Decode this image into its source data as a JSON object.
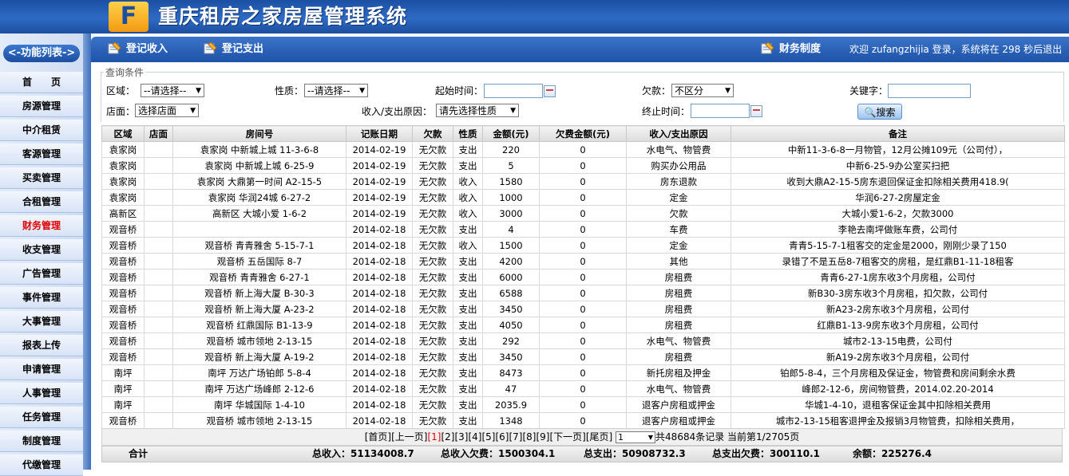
{
  "header": {
    "logo_text": "F",
    "title": "重庆租房之家房屋管理系统"
  },
  "sidebar": {
    "header": "<-功能列表->",
    "items": [
      {
        "label": "首　　页"
      },
      {
        "label": "房源管理"
      },
      {
        "label": "中介租赁"
      },
      {
        "label": "客源管理"
      },
      {
        "label": "买卖管理"
      },
      {
        "label": "合租管理"
      },
      {
        "label": "财务管理",
        "active": true
      },
      {
        "label": "收支管理"
      },
      {
        "label": "广告管理"
      },
      {
        "label": "事件管理"
      },
      {
        "label": "大事管理"
      },
      {
        "label": "报表上传"
      },
      {
        "label": "申请管理"
      },
      {
        "label": "人事管理"
      },
      {
        "label": "任务管理"
      },
      {
        "label": "制度管理"
      },
      {
        "label": "代缴管理"
      }
    ]
  },
  "toolbar": {
    "income_label": "登记收入",
    "expense_label": "登记支出",
    "finance_rules_label": "财务制度",
    "welcome_text": "欢迎 zufangzhijia 登录，系统将在 298 秒后退出"
  },
  "query": {
    "legend": "查询条件",
    "region_label": "区域：",
    "region_value": "--请选择--",
    "nature_label": "性质：",
    "nature_value": "--请选择--",
    "start_label": "起始时间：",
    "debt_label": "欠款：",
    "debt_value": "不区分",
    "keyword_label": "关键字：",
    "store_label": "店面：",
    "store_value": "选择店面",
    "reason_label": "收入/支出原因：",
    "reason_value": "请先选择性质",
    "end_label": "终止时间：",
    "search_label": "搜索"
  },
  "table": {
    "headers": [
      "区域",
      "店面",
      "房间号",
      "记账日期",
      "欠款",
      "性质",
      "金额(元)",
      "欠费金额(元)",
      "收入/支出原因",
      "备注"
    ],
    "rows": [
      [
        "袁家岗",
        "",
        "袁家岗 中新城上城 11-3-6-8",
        "2014-02-19",
        "无欠款",
        "支出",
        "220",
        "0",
        "水电气、物管费",
        "中新11-3-6-8一月物管，12月公摊109元（公司付），"
      ],
      [
        "袁家岗",
        "",
        "袁家岗 中新城上城 6-25-9",
        "2014-02-19",
        "无欠款",
        "支出",
        "5",
        "0",
        "购买办公用品",
        "中新6-25-9办公室买扫把"
      ],
      [
        "袁家岗",
        "",
        "袁家岗 大鼎第一时间 A2-15-5",
        "2014-02-19",
        "无欠款",
        "收入",
        "1580",
        "0",
        "房东退款",
        "收到大鼎A2-15-5房东退回保证金扣除相关费用418.9("
      ],
      [
        "袁家岗",
        "",
        "袁家岗 华润24城 6-27-2",
        "2014-02-19",
        "无欠款",
        "收入",
        "1000",
        "0",
        "定金",
        "华润6-27-2房屋定金"
      ],
      [
        "高新区",
        "",
        "高新区 大城小爱 1-6-2",
        "2014-02-19",
        "无欠款",
        "收入",
        "3000",
        "0",
        "欠款",
        "大城小爱1-6-2，欠款3000"
      ],
      [
        "观音桥",
        "",
        "",
        "2014-02-18",
        "无欠款",
        "支出",
        "4",
        "0",
        "车费",
        "李艳去南坪做账车费，公司付"
      ],
      [
        "观音桥",
        "",
        "观音桥 青青雅舍 5-15-7-1",
        "2014-02-18",
        "无欠款",
        "收入",
        "1500",
        "0",
        "定金",
        "青青5-15-7-1租客交的定金是2000，刚刚少录了150"
      ],
      [
        "观音桥",
        "",
        "观音桥 五岳国际 8-7",
        "2014-02-18",
        "无欠款",
        "支出",
        "4200",
        "0",
        "其他",
        "录错了不是五岳8-7租客交的房租，是红鼎B1-11-18租客"
      ],
      [
        "观音桥",
        "",
        "观音桥 青青雅舍 6-27-1",
        "2014-02-18",
        "无欠款",
        "支出",
        "6000",
        "0",
        "房租费",
        "青青6-27-1房东收3个月房租，公司付"
      ],
      [
        "观音桥",
        "",
        "观音桥 新上海大厦 B-30-3",
        "2014-02-18",
        "无欠款",
        "支出",
        "6588",
        "0",
        "房租费",
        "新B30-3房东收3个月房租，扣欠款，公司付"
      ],
      [
        "观音桥",
        "",
        "观音桥 新上海大厦 A-23-2",
        "2014-02-18",
        "无欠款",
        "支出",
        "3450",
        "0",
        "房租费",
        "新A23-2房东收3个月房租，公司付"
      ],
      [
        "观音桥",
        "",
        "观音桥 红鼎国际 B1-13-9",
        "2014-02-18",
        "无欠款",
        "支出",
        "4050",
        "0",
        "房租费",
        "红鼎B1-13-9房东收3个月房租，公司付"
      ],
      [
        "观音桥",
        "",
        "观音桥 城市领地 2-13-15",
        "2014-02-18",
        "无欠款",
        "支出",
        "292",
        "0",
        "水电气、物管费",
        "城市2-13-15电费，公司付"
      ],
      [
        "观音桥",
        "",
        "观音桥 新上海大厦 A-19-2",
        "2014-02-18",
        "无欠款",
        "支出",
        "3450",
        "0",
        "房租费",
        "新A19-2房东收3个月房租，公司付"
      ],
      [
        "南坪",
        "",
        "南坪 万达广场铂郎 5-8-4",
        "2014-02-18",
        "无欠款",
        "支出",
        "8473",
        "0",
        "新托房租及押金",
        "铂郎5-8-4，三个月房租及保证金，物管费和房间剩余水费"
      ],
      [
        "南坪",
        "",
        "南坪 万达广场峰郎 2-12-6",
        "2014-02-18",
        "无欠款",
        "支出",
        "47",
        "0",
        "水电气、物管费",
        "峰郎2-12-6，房间物管费，2014.02.20-2014"
      ],
      [
        "南坪",
        "",
        "南坪 华城国际 1-4-10",
        "2014-02-18",
        "无欠款",
        "支出",
        "2035.9",
        "0",
        "退客户房租或押金",
        "华城1-4-10，退租客保证金其中扣除相关费用"
      ],
      [
        "观音桥",
        "",
        "观音桥 城市领地 2-13-15",
        "2014-02-18",
        "无欠款",
        "支出",
        "1348",
        "0",
        "退客户房租或押金",
        "城市2-13-15租客退押金及报销3月物管费，扣除相关费用，"
      ]
    ]
  },
  "pager": {
    "first": "[首页]",
    "prev": "[上一页]",
    "current": "[1]",
    "pages": [
      "[2]",
      "[3]",
      "[4]",
      "[5]",
      "[6]",
      "[7]",
      "[8]",
      "[9]"
    ],
    "next": "[下一页]",
    "last": "[尾页]",
    "select_value": "1",
    "summary": "共48684条记录 当前第1/2705页"
  },
  "totals": {
    "label": "合计",
    "total_income": "总收入：51134008.7",
    "income_debt": "总收入欠费：1500304.1",
    "total_expense": "总支出：50908732.3",
    "expense_debt": "总支出欠费：300110.1",
    "balance": "余额：225276.4"
  }
}
